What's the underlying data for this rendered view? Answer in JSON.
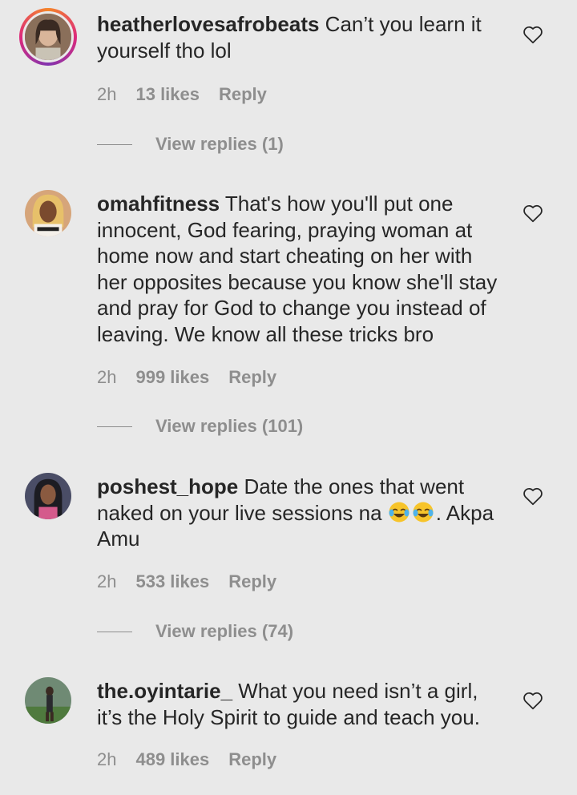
{
  "comments": [
    {
      "username": "heatherlovesafrobeats",
      "text": " Can’t you learn it yourself tho lol",
      "time": "2h",
      "likes": "13 likes",
      "reply_label": "Reply",
      "view_replies": "View replies (1)",
      "avatar": "avatar-with-story-ring"
    },
    {
      "username": "omahfitness",
      "text": " That's how you'll put one innocent, God fearing, praying woman at home now and start cheating on her with her opposites because you know she'll stay and pray for God to change you instead of leaving. We know all these tricks bro",
      "time": "2h",
      "likes": "999 likes",
      "reply_label": "Reply",
      "view_replies": "View replies (101)",
      "avatar": "avatar"
    },
    {
      "username": "poshest_hope",
      "text_before_emoji": " Date the ones that went naked on your live sessions na ",
      "emoji_icons": [
        "face-with-tears-of-joy-icon",
        "face-with-tears-of-joy-icon"
      ],
      "text_after_emoji": ". Akpa Amu",
      "time": "2h",
      "likes": "533 likes",
      "reply_label": "Reply",
      "view_replies": "View replies (74)",
      "avatar": "avatar"
    },
    {
      "username": "the.oyintarie_",
      "text": " What you need isn’t a girl, it’s the Holy Spirit to guide and teach you.",
      "time": "2h",
      "likes": "489 likes",
      "reply_label": "Reply",
      "avatar": "avatar"
    }
  ],
  "icons": {
    "like": "heart-outline-icon"
  },
  "colors": {
    "background": "#e9e9e9",
    "text": "#262626",
    "meta": "#8e8e8e"
  }
}
